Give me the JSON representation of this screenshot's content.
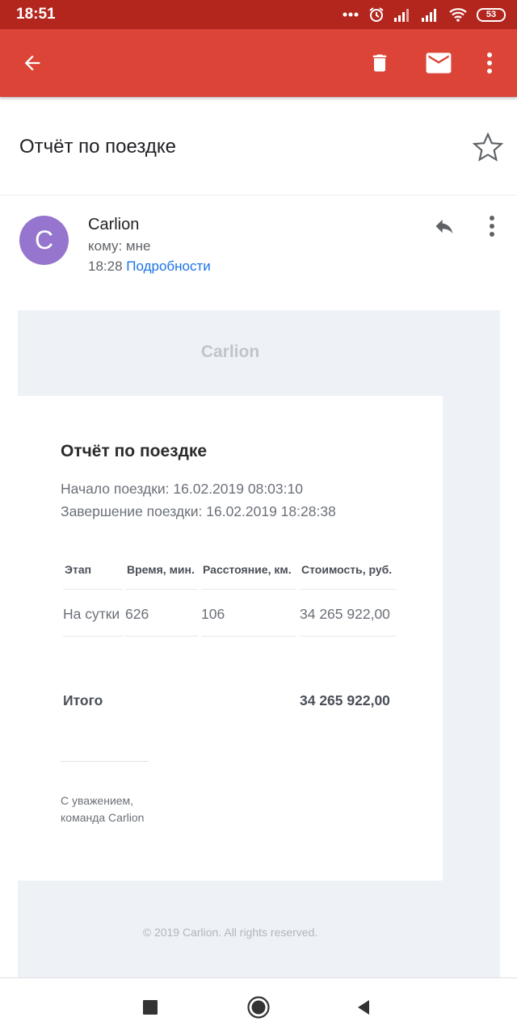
{
  "status_bar": {
    "time": "18:51",
    "battery": "53"
  },
  "app_bar": {
    "back_icon": "arrow-back-icon",
    "delete_icon": "trash-icon",
    "mark_unread_icon": "envelope-icon",
    "more_icon": "more-vert-icon"
  },
  "email": {
    "subject": "Отчёт по поездке",
    "sender": "Carlion",
    "avatar_letter": "C",
    "recipient": "кому: мне",
    "time": "18:28",
    "details_link": "Подробности"
  },
  "message": {
    "brand": "Carlion",
    "title": "Отчёт по поездке",
    "start": "Начало поездки: 16.02.2019 08:03:10",
    "end": "Завершение поездки: 16.02.2019 18:28:38",
    "table": {
      "headers": [
        "Этап",
        "Время, мин.",
        "Расстояние, км.",
        "Стоимость, руб."
      ],
      "rows": [
        [
          "На сутки",
          "626",
          "106",
          "34 265 922,00"
        ]
      ]
    },
    "total_label": "Итого",
    "total_value": "34 265 922,00",
    "regards_line1": "С уважением,",
    "regards_line2": "команда Carlion",
    "footer": "© 2019 Carlion. All rights reserved."
  },
  "colors": {
    "app_bar": "#db4437",
    "status_bar": "#b3261e",
    "avatar": "#9575cd",
    "link": "#1a73e8"
  }
}
